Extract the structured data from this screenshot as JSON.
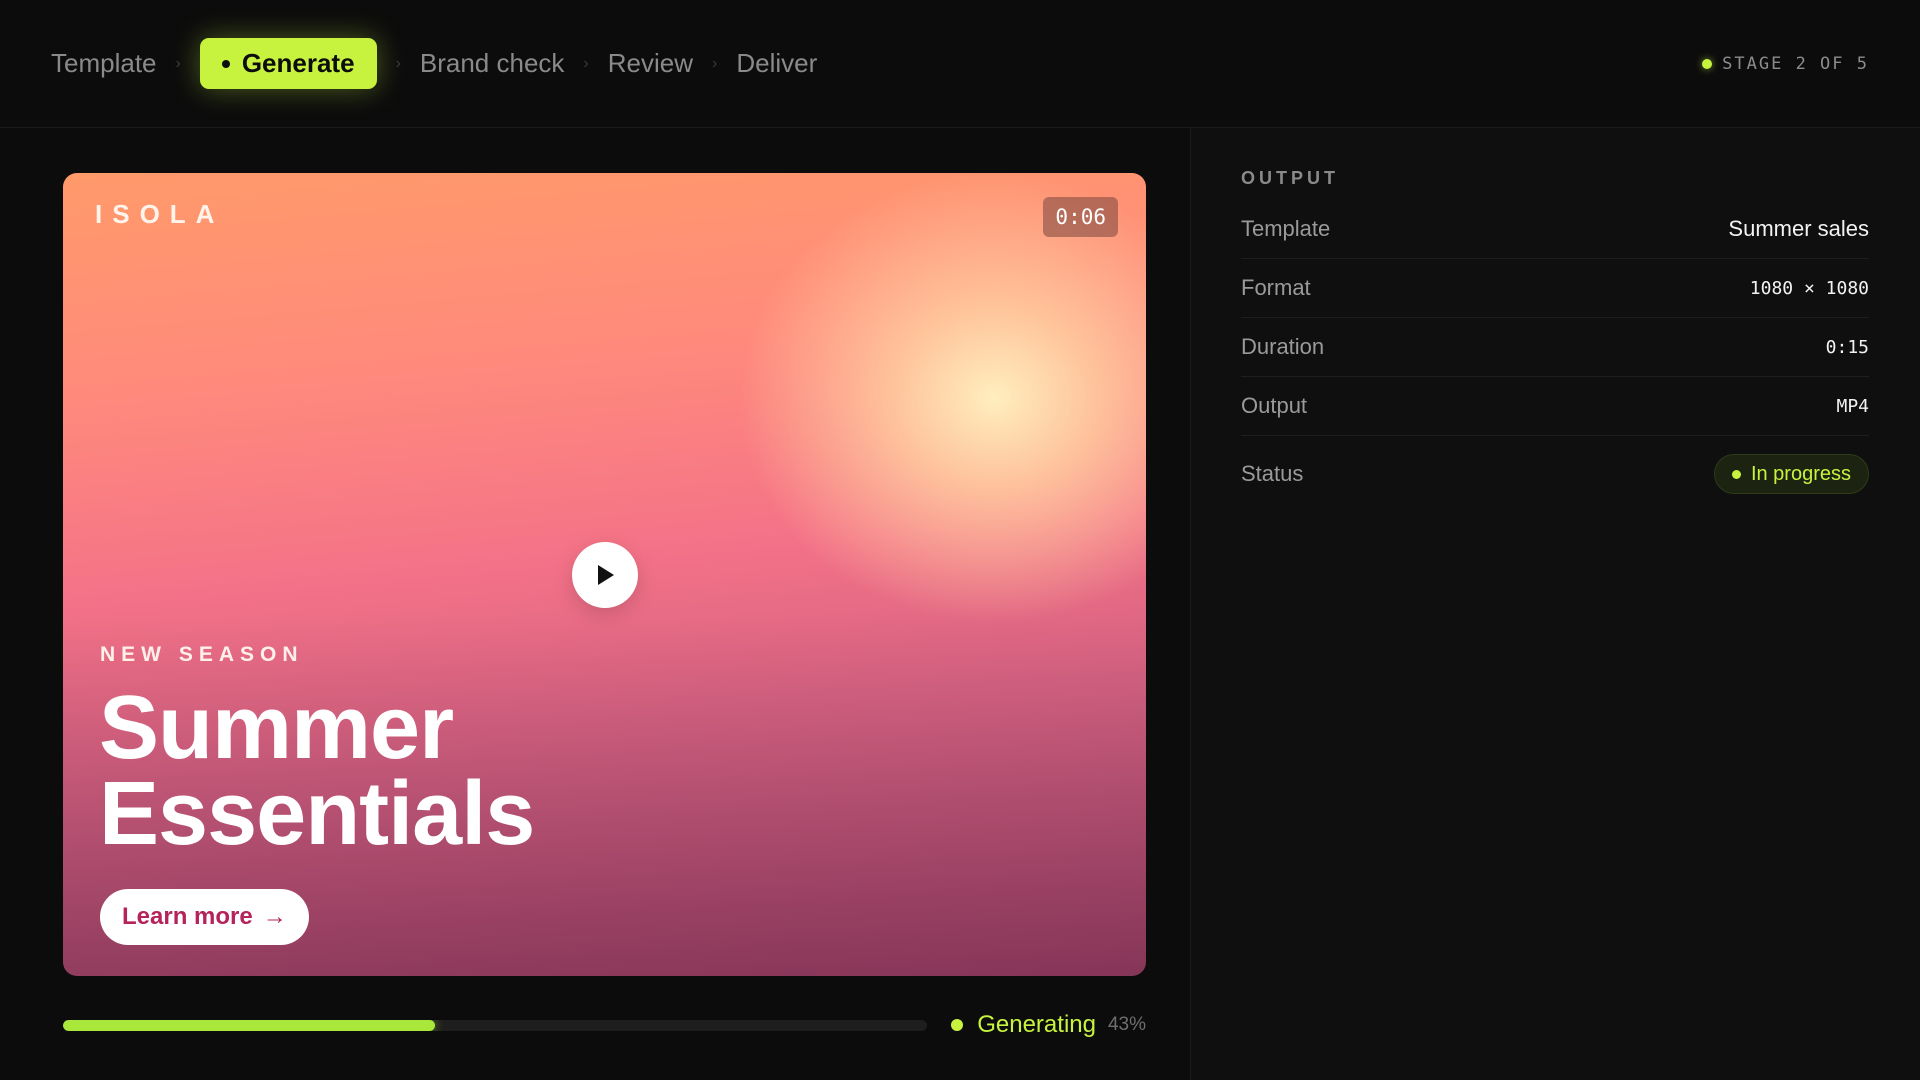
{
  "pipeline": {
    "steps": [
      {
        "label": "Template",
        "active": false
      },
      {
        "label": "Generate",
        "active": true
      },
      {
        "label": "Brand check",
        "active": false
      },
      {
        "label": "Review",
        "active": false
      },
      {
        "label": "Deliver",
        "active": false
      }
    ],
    "stage_text": "STAGE 2 OF 5"
  },
  "preview": {
    "brand": "ISOLA",
    "timecode": "0:06",
    "eyebrow": "NEW SEASON",
    "headline_line1": "Summer",
    "headline_line2": "Essentials",
    "cta_label": "Learn more",
    "cta_arrow": "→"
  },
  "progress": {
    "label": "Generating",
    "percent_text": "43%",
    "value": 0.43
  },
  "output": {
    "title": "OUTPUT",
    "rows": [
      {
        "key": "Template",
        "value": "Summer sales"
      },
      {
        "key": "Format",
        "value": "1080 × 1080"
      },
      {
        "key": "Duration",
        "value": "0:15"
      },
      {
        "key": "Output",
        "value": "MP4"
      }
    ],
    "status_key": "Status",
    "status_value": "In progress"
  },
  "colors": {
    "accent": "#c7f33f",
    "background": "#0c0c0c",
    "panel": "#0f0f0f",
    "cta_text": "#b4245a"
  },
  "icons": {
    "play": "play-icon",
    "status": "status-dot-icon",
    "chevron": "chevron-right-icon"
  }
}
